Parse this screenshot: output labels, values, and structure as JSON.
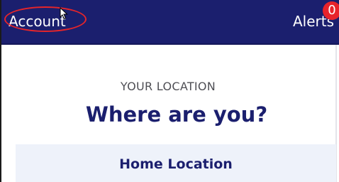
{
  "header": {
    "account_label": "Account",
    "alerts_label": "Alerts",
    "alerts_count": "0"
  },
  "location": {
    "eyebrow": "YOUR LOCATION",
    "heading": "Where are you?",
    "home_location_label": "Home Location"
  },
  "colors": {
    "header_bg": "#1b1f6e",
    "highlight_ring": "#e5252a",
    "badge": "#e8232b",
    "card_bg": "#eef2fa",
    "heading": "#1b1f6e"
  },
  "icons": {
    "pointer": "mouse-cursor-icon"
  }
}
